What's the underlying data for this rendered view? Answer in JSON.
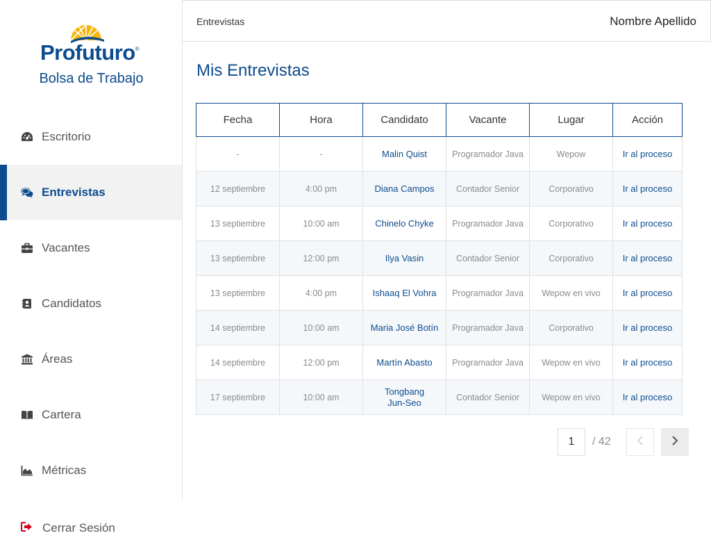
{
  "brand": {
    "logo_text": "Profuturo",
    "subtitle": "Bolsa de Trabajo"
  },
  "nav": [
    {
      "label": "Escritorio",
      "icon": "dashboard-icon"
    },
    {
      "label": "Entrevistas",
      "icon": "comments-icon",
      "active": true
    },
    {
      "label": "Vacantes",
      "icon": "briefcase-icon"
    },
    {
      "label": "Candidatos",
      "icon": "contact-book-icon"
    },
    {
      "label": "Áreas",
      "icon": "bank-icon"
    },
    {
      "label": "Cartera",
      "icon": "book-icon"
    },
    {
      "label": "Métricas",
      "icon": "area-chart-icon"
    }
  ],
  "logout": {
    "label": "Cerrar Sesión",
    "icon": "sign-out-icon"
  },
  "header": {
    "breadcrumb": "Entrevistas",
    "user_name": "Nombre Apellido"
  },
  "page": {
    "title": "Mis Entrevistas"
  },
  "table": {
    "columns": [
      "Fecha",
      "Hora",
      "Candidato",
      "Vacante",
      "Lugar",
      "Acción"
    ],
    "rows": [
      {
        "fecha": "-",
        "hora": "-",
        "candidato": "Malin Quist",
        "vacante": "Programador Java",
        "lugar": "Wepow",
        "accion": "Ir al proceso"
      },
      {
        "fecha": "12 septiembre",
        "hora": "4:00 pm",
        "candidato": "Diana Campos",
        "vacante": "Contador Senior",
        "lugar": "Corporativo",
        "accion": "Ir al proceso"
      },
      {
        "fecha": "13 septiembre",
        "hora": "10:00 am",
        "candidato": "Chinelo Chyke",
        "vacante": "Programador Java",
        "lugar": "Corporativo",
        "accion": "Ir al proceso"
      },
      {
        "fecha": "13 septiembre",
        "hora": "12:00 pm",
        "candidato": "Ilya Vasin",
        "vacante": "Contador Senior",
        "lugar": "Corporativo",
        "accion": "Ir al proceso"
      },
      {
        "fecha": "13 septiembre",
        "hora": "4:00 pm",
        "candidato": "Ishaaq El Vohra",
        "vacante": "Programador Java",
        "lugar": "Wepow en vivo",
        "accion": "Ir al proceso"
      },
      {
        "fecha": "14 septiembre",
        "hora": "10:00 am",
        "candidato": "Maria José Botín",
        "vacante": "Programador Java",
        "lugar": "Corporativo",
        "accion": "Ir al proceso"
      },
      {
        "fecha": "14 septiembre",
        "hora": "12:00 pm",
        "candidato": "Martín Abasto",
        "vacante": "Programador Java",
        "lugar": "Wepow en vivo",
        "accion": "Ir al proceso"
      },
      {
        "fecha": "17 septiembre",
        "hora": "10:00 am",
        "candidato": "Tongbang Jun-Seo",
        "vacante": "Contador Senior",
        "lugar": "Wepow en vivo",
        "accion": "Ir al proceso"
      }
    ]
  },
  "pagination": {
    "current_page": "1",
    "total_label": "/ 42"
  },
  "colors": {
    "brand_blue": "#0c4b8e",
    "logo_yellow": "#f5b50a",
    "logout_red": "#d0021b",
    "active_bg": "#f2f2f2"
  }
}
